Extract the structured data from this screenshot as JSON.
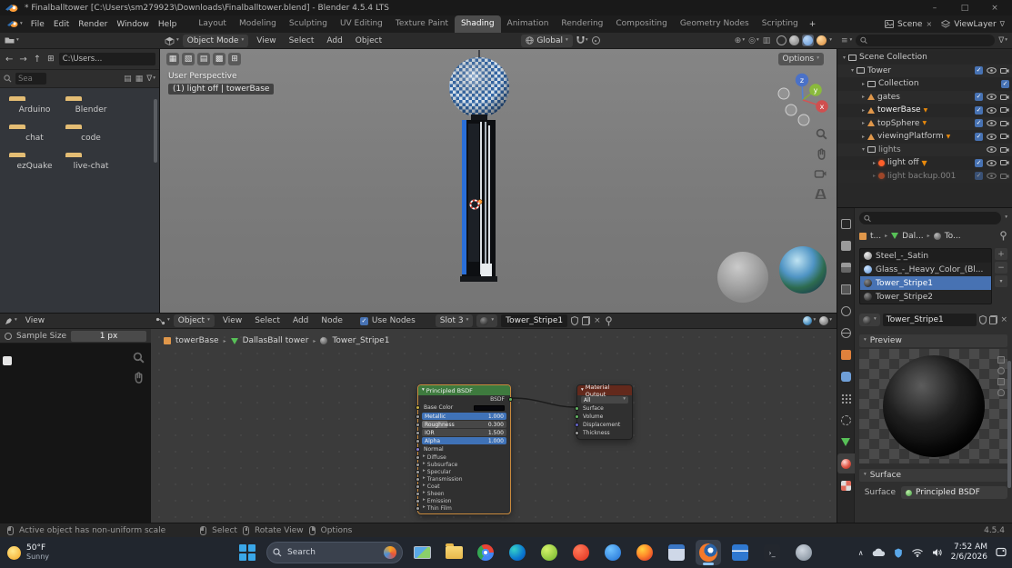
{
  "colors": {
    "accent_blue": "#4772b3",
    "blender_orange": "#e87d0d",
    "viewport_gray": "#7d7d7d",
    "bsdf_header_green": "#3e7a3e",
    "output_header_red": "#63291c"
  },
  "window": {
    "title": "* Finalballtower [C:\\Users\\sm279923\\Downloads\\Finalballtower.blend] - Blender 4.5.4 LTS"
  },
  "topbar": {
    "menus": [
      {
        "label": "File"
      },
      {
        "label": "Edit"
      },
      {
        "label": "Render"
      },
      {
        "label": "Window"
      },
      {
        "label": "Help"
      }
    ],
    "workspaces": [
      {
        "label": "Layout"
      },
      {
        "label": "Modeling"
      },
      {
        "label": "Sculpting"
      },
      {
        "label": "UV Editing"
      },
      {
        "label": "Texture Paint"
      },
      {
        "label": "Shading"
      },
      {
        "label": "Animation"
      },
      {
        "label": "Rendering"
      },
      {
        "label": "Compositing"
      },
      {
        "label": "Geometry Nodes"
      },
      {
        "label": "Scripting"
      }
    ],
    "add_workspace": "+",
    "scene_label": "Scene",
    "view_layer_label": "ViewLayer"
  },
  "viewport": {
    "header": {
      "mode": "Object Mode",
      "menu_view": "View",
      "menu_select": "Select",
      "menu_add": "Add",
      "menu_object": "Object",
      "orientation": "Global"
    },
    "options_label": "Options",
    "perspective_label": "User Perspective",
    "context_label": "(1) light off | towerBase",
    "axis": {
      "x": "x",
      "y": "y",
      "z": "z"
    }
  },
  "file_browser": {
    "path": "C:\\Users...",
    "search_placeholder": "Sea",
    "folders": [
      {
        "name": "Arduino"
      },
      {
        "name": "Blender"
      },
      {
        "name": "chat"
      },
      {
        "name": "code"
      },
      {
        "name": "ezQuake"
      },
      {
        "name": "live-chat"
      }
    ]
  },
  "outliner": {
    "rows": [
      {
        "label": "Scene Collection"
      },
      {
        "label": "Tower"
      },
      {
        "label": "Collection"
      },
      {
        "label": "gates"
      },
      {
        "label": "towerBase"
      },
      {
        "label": "topSphere"
      },
      {
        "label": "viewingPlatform"
      },
      {
        "label": "lights"
      },
      {
        "label": "light off"
      },
      {
        "label": "light backup.001"
      }
    ]
  },
  "properties": {
    "breadcrumb": {
      "object": "t...",
      "data": "Dal...",
      "material": "To..."
    },
    "slots": [
      {
        "name": "Steel_-_Satin"
      },
      {
        "name": "Glass_-_Heavy_Color_(Bl..."
      },
      {
        "name": "Tower_Stripe1"
      },
      {
        "name": "Tower_Stripe2"
      }
    ],
    "material_name": "Tower_Stripe1",
    "preview_section": "Preview",
    "surface_section": "Surface",
    "surface_label": "Surface",
    "surface_value": "Principled BSDF"
  },
  "image_editor": {
    "menu_view": "View",
    "sample_size_label": "Sample Size",
    "sample_size_value": "1 px"
  },
  "shader_editor": {
    "header": {
      "shader_type": "Object",
      "menu_view": "View",
      "menu_select": "Select",
      "menu_add": "Add",
      "menu_node": "Node",
      "use_nodes": "Use Nodes",
      "slot": "Slot 3",
      "material": "Tower_Stripe1"
    },
    "path": {
      "object": "towerBase",
      "data": "DallasBall tower",
      "material": "Tower_Stripe1"
    },
    "bsdf": {
      "title": "Principled BSDF",
      "output_socket": "BSDF",
      "base_color_label": "Base Color",
      "metallic_label": "Metallic",
      "metallic_value": "1.000",
      "roughness_label": "Roughness",
      "roughness_value": "0.300",
      "ior_label": "IOR",
      "ior_value": "1.500",
      "alpha_label": "Alpha",
      "alpha_value": "1.000",
      "normal_label": "Normal",
      "sections": [
        {
          "label": "Diffuse"
        },
        {
          "label": "Subsurface"
        },
        {
          "label": "Specular"
        },
        {
          "label": "Transmission"
        },
        {
          "label": "Coat"
        },
        {
          "label": "Sheen"
        },
        {
          "label": "Emission"
        },
        {
          "label": "Thin Film"
        }
      ]
    },
    "output_node": {
      "title": "Material Output",
      "target": "All",
      "inputs": [
        {
          "label": "Surface"
        },
        {
          "label": "Volume"
        },
        {
          "label": "Displacement"
        },
        {
          "label": "Thickness"
        }
      ]
    }
  },
  "status_bar": {
    "message": "Active object has non-uniform scale",
    "hint_select": "Select",
    "hint_rotate": "Rotate View",
    "hint_options": "Options",
    "version": "4.5.4"
  },
  "taskbar": {
    "weather_temp": "50°F",
    "weather_desc": "Sunny",
    "search_label": "Search",
    "clock_time": "7:52 AM",
    "clock_date": "2/6/2026"
  }
}
